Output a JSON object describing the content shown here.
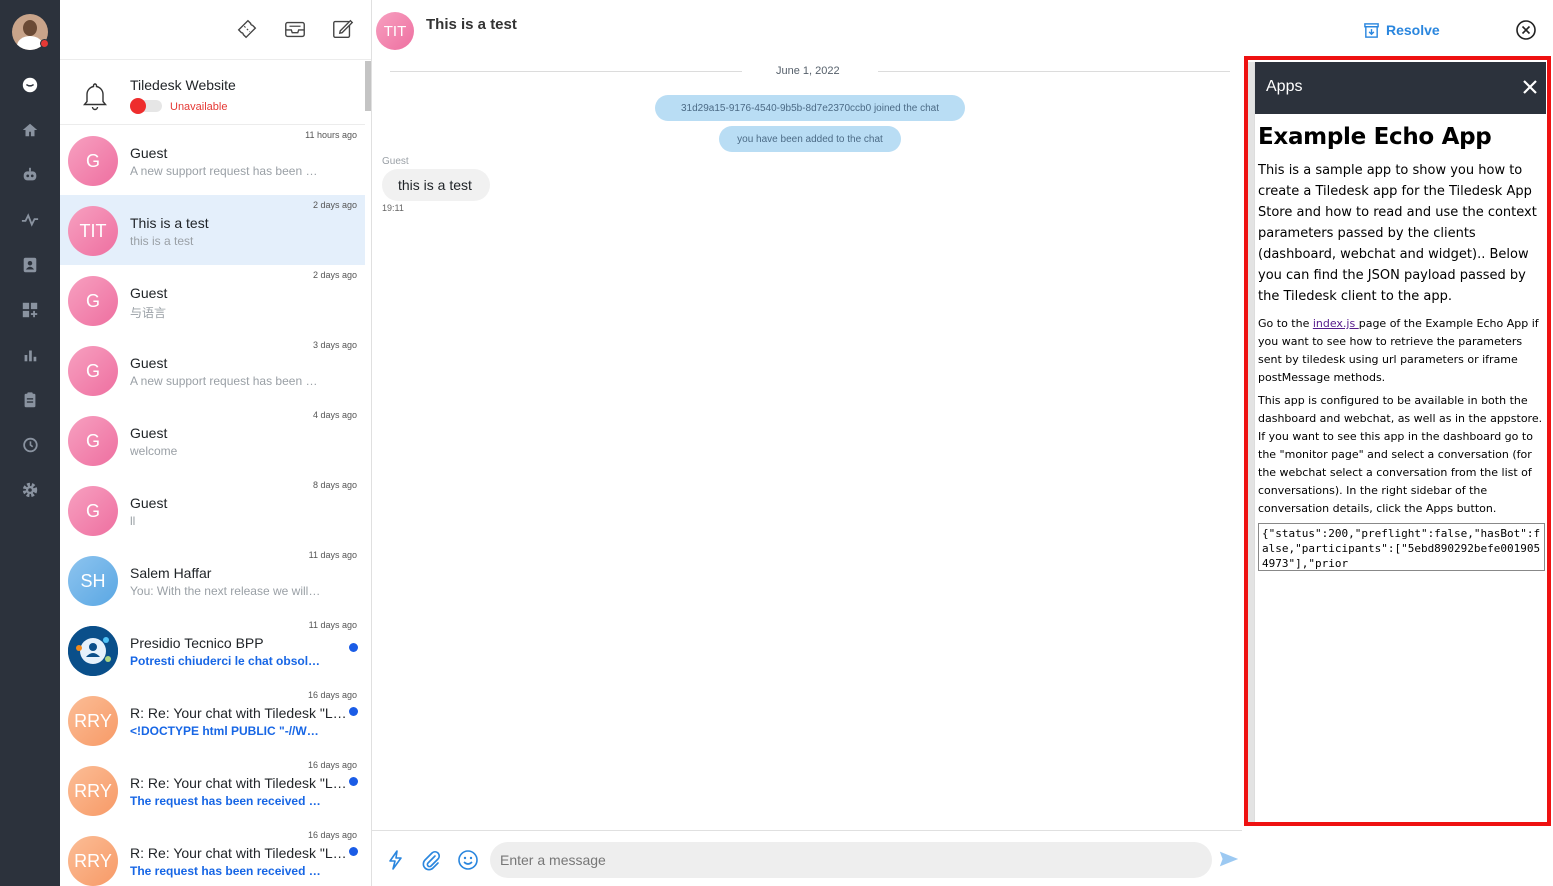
{
  "nav": {
    "icons": [
      "chat-icon",
      "home-icon",
      "bot-icon",
      "activity-icon",
      "contacts-icon",
      "apps-grid-icon",
      "analytics-icon",
      "clipboard-icon",
      "history-icon",
      "settings-icon"
    ]
  },
  "project": {
    "name": "Tiledesk Website",
    "status": "Unavailable"
  },
  "conversations": [
    {
      "initials": "G",
      "name": "Guest",
      "preview": "A new support request has been …",
      "time": "11 hours ago",
      "unread": false
    },
    {
      "initials": "TIT",
      "name": "This is a test",
      "preview": "this is a test",
      "time": "2 days ago",
      "unread": false
    },
    {
      "initials": "G",
      "name": "Guest",
      "preview": "与语言",
      "time": "2 days ago",
      "unread": false
    },
    {
      "initials": "G",
      "name": "Guest",
      "preview": "A new support request has been …",
      "time": "3 days ago",
      "unread": false
    },
    {
      "initials": "G",
      "name": "Guest",
      "preview": "welcome",
      "time": "4 days ago",
      "unread": false
    },
    {
      "initials": "G",
      "name": "Guest",
      "preview": "ll",
      "time": "8 days ago",
      "unread": false
    },
    {
      "initials": "SH",
      "name": "Salem Haffar",
      "preview": "You: With the next release we will…",
      "time": "11 days ago",
      "unread": false
    },
    {
      "initials": "",
      "name": "Presidio Tecnico BPP",
      "preview": "Potresti chiuderci le chat obsol…",
      "time": "11 days ago",
      "unread": true
    },
    {
      "initials": "RRY",
      "name": "R: Re: Your chat with Tiledesk \"L…",
      "preview": "<!DOCTYPE html PUBLIC \"-//W…",
      "time": "16 days ago",
      "unread": true
    },
    {
      "initials": "RRY",
      "name": "R: Re: Your chat with Tiledesk \"L…",
      "preview": "The request has been received …",
      "time": "16 days ago",
      "unread": true
    },
    {
      "initials": "RRY",
      "name": "R: Re: Your chat with Tiledesk \"L…",
      "preview": "The request has been received …",
      "time": "16 days ago",
      "unread": true
    }
  ],
  "chat": {
    "avatar": "TIT",
    "title": "This is a test",
    "date": "June 1, 2022",
    "system_messages": [
      "31d29a15-9176-4540-9b5b-8d7e2370ccb0 joined the chat",
      "you have been added to the chat"
    ],
    "sender": "Guest",
    "message": "this is a test",
    "message_time": "19:11",
    "input_placeholder": "Enter a message"
  },
  "toolbar": {
    "resolve_label": "Resolve"
  },
  "apps_panel": {
    "title": "Apps",
    "app_title": "Example Echo App",
    "intro": "This is a sample app to show you how to create a Tiledesk app for the Tiledesk App Store and how to read and use the context parameters passed by the clients (dashboard, webchat and widget).. Below you can find the JSON payload passed by the Tiledesk client to the app.",
    "para2_before": "Go to the ",
    "para2_link": "index.js ",
    "para2_after": "page of the Example Echo App if you want to see how to retrieve the parameters sent by tiledesk using url parameters or iframe postMessage methods.",
    "para3": "This app is configured to be available in both the dashboard and webchat, as well as in the appstore. If you want to see this app in the dashboard go to the \"monitor page\" and select a conversation (for the webchat select a conversation from the list of conversations). In the right sidebar of the conversation details, click the Apps button.",
    "json_payload": "{\"status\":200,\"preflight\":false,\"hasBot\":false,\"participants\":[\"5ebd890292befe0019054973\"],\"prior"
  },
  "colors": {
    "nav_bg": "#2c323c",
    "accent_blue": "#2a86de",
    "unread_blue": "#1766e5",
    "selected_bg": "#e4effb",
    "alert_red": "#e53935"
  }
}
